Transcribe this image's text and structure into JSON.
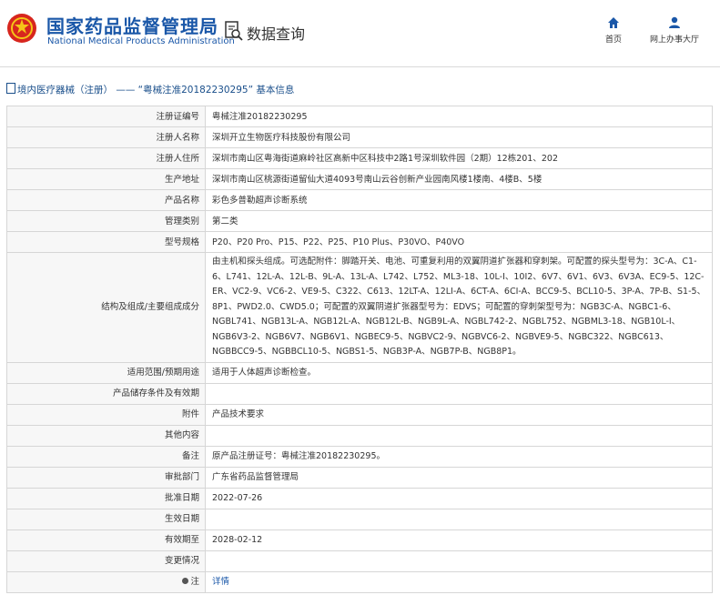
{
  "header": {
    "logo_cn": "国家药品监督管理局",
    "logo_en": "National Medical Products Administration",
    "query_label": "数据查询",
    "nav": [
      {
        "label": "首页",
        "icon": "home-icon"
      },
      {
        "label": "网上办事大厅",
        "icon": "user-icon"
      }
    ]
  },
  "breadcrumb": "境内医疗器械（注册） —— “粤械注准20182230295” 基本信息",
  "rows": [
    {
      "key": "注册证编号",
      "value": "粤械注准20182230295"
    },
    {
      "key": "注册人名称",
      "value": "深圳开立生物医疗科技股份有限公司"
    },
    {
      "key": "注册人住所",
      "value": "深圳市南山区粤海街道麻岭社区高新中区科技中2路1号深圳软件园（2期）12栋201、202"
    },
    {
      "key": "生产地址",
      "value": "深圳市南山区桃源街道留仙大道4093号南山云谷创新产业园南风楼1楼南、4楼B、5楼"
    },
    {
      "key": "产品名称",
      "value": "彩色多普勒超声诊断系统"
    },
    {
      "key": "管理类别",
      "value": "第二类"
    },
    {
      "key": "型号规格",
      "value": "P20、P20 Pro、P15、P22、P25、P10 Plus、P30VO、P40VO"
    },
    {
      "key": "结构及组成/主要组成成分",
      "value": "由主机和探头组成。可选配附件：脚踏开关、电池、可重复利用的双翼阴道扩张器和穿刺架。可配置的探头型号为：3C-A、C1-6、L741、12L-A、12L-B、9L-A、13L-A、L742、L752、ML3-18、10L-I、10I2、6V7、6V1、6V3、6V3A、EC9-5、12C-ER、VC2-9、VC6-2、VE9-5、C322、C613、12LT-A、12LI-A、6CT-A、6CI-A、BCC9-5、BCL10-5、3P-A、7P-B、S1-5、8P1、PWD2.0、CWD5.0；可配置的双翼阴道扩张器型号为：EDVS；可配置的穿刺架型号为：NGB3C-A、NGBC1-6、NGBL741、NGB13L-A、NGB12L-A、NGB12L-B、NGB9L-A、NGBL742-2、NGBL752、NGBML3-18、NGB10L-I、NGB6V3-2、NGB6V7、NGB6V1、NGBEC9-5、NGBVC2-9、NGBVC6-2、NGBVE9-5、NGBC322、NGBC613、NGBBCC9-5、NGBBCL10-5、NGBS1-5、NGB3P-A、NGB7P-B、NGB8P1。"
    },
    {
      "key": "适用范围/预期用途",
      "value": "适用于人体超声诊断检查。"
    },
    {
      "key": "产品储存条件及有效期",
      "value": ""
    },
    {
      "key": "附件",
      "value": "产品技术要求"
    },
    {
      "key": "其他内容",
      "value": ""
    },
    {
      "key": "备注",
      "value": "原产品注册证号：粤械注准20182230295。"
    },
    {
      "key": "审批部门",
      "value": "广东省药品监督管理局"
    },
    {
      "key": "批准日期",
      "value": "2022-07-26"
    },
    {
      "key": "生效日期",
      "value": ""
    },
    {
      "key": "有效期至",
      "value": "2028-02-12"
    },
    {
      "key": "变更情况",
      "value": ""
    },
    {
      "key": "注",
      "value": "详情",
      "key_icon": "info-icon"
    }
  ]
}
